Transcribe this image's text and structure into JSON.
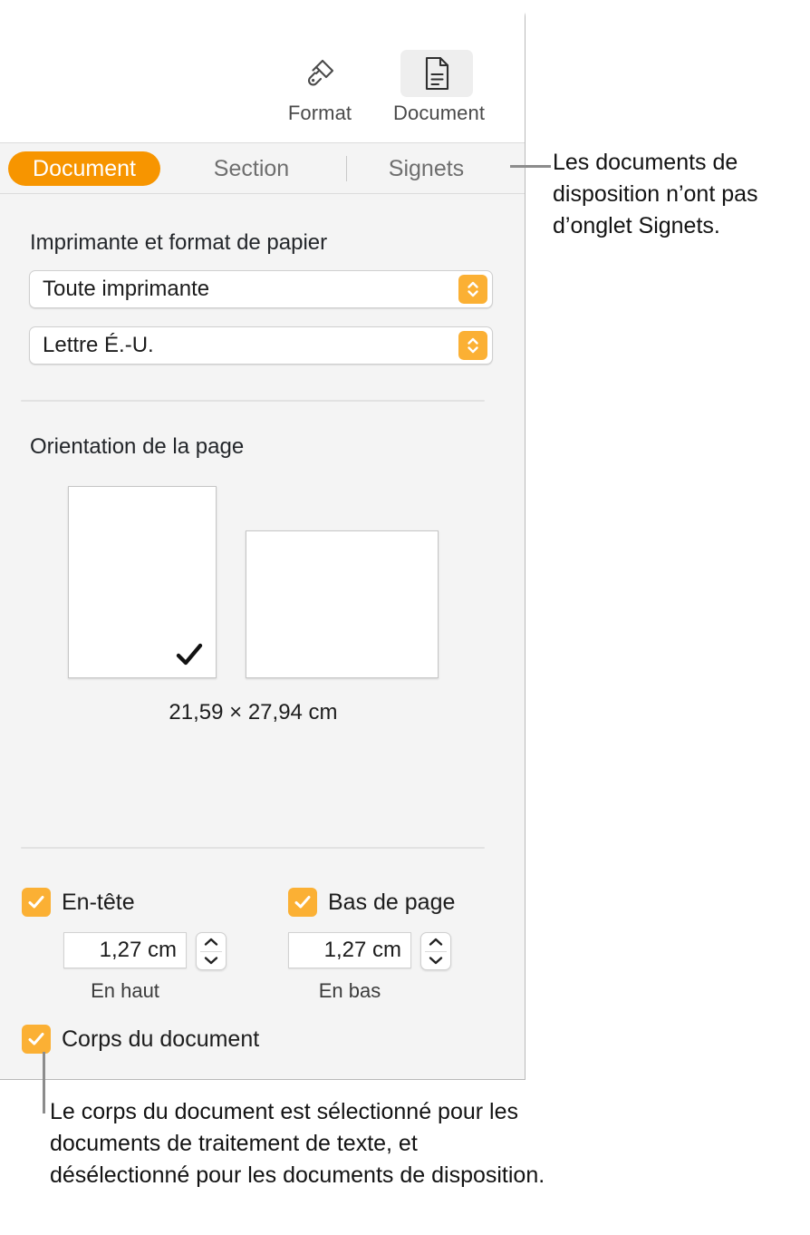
{
  "inspector": {
    "toolbar": {
      "items": [
        {
          "label": "Format",
          "icon": "paintbrush-icon",
          "selected": false
        },
        {
          "label": "Document",
          "icon": "document-icon",
          "selected": true
        }
      ]
    },
    "tabs": [
      {
        "label": "Document",
        "active": true
      },
      {
        "label": "Section",
        "active": false
      },
      {
        "label": "Signets",
        "active": false
      }
    ],
    "printer_section": {
      "title": "Imprimante et format de papier",
      "printer_value": "Toute imprimante",
      "paper_value": "Lettre É.-U."
    },
    "orientation_section": {
      "title": "Orientation de la page",
      "portrait_selected": true,
      "landscape_selected": false,
      "dimensions": "21,59 × 27,94 cm"
    },
    "margins_section": {
      "header": {
        "label": "En-tête",
        "checked": true,
        "value": "1,27 cm",
        "sublabel": "En haut"
      },
      "footer": {
        "label": "Bas de page",
        "checked": true,
        "value": "1,27 cm",
        "sublabel": "En bas"
      },
      "body": {
        "label": "Corps du document",
        "checked": true
      }
    }
  },
  "callouts": {
    "top": "Les documents de disposition n’ont pas d’onglet Signets.",
    "bottom": "Le corps du document est sélectionné pour les documents de traitement de texte, et désélectionné pour les documents de disposition."
  },
  "colors": {
    "accent_orange": "#F79500",
    "control_orange": "#FBB034",
    "panel_background": "#F4F4F4",
    "text_primary": "#1C1C1C",
    "text_secondary": "#6E6E6E"
  }
}
